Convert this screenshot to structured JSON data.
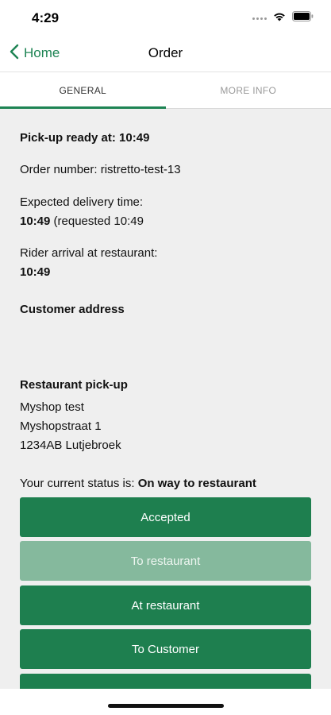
{
  "status_bar": {
    "time": "4:29"
  },
  "nav": {
    "back_label": "Home",
    "title": "Order"
  },
  "tabs": [
    {
      "label": "GENERAL",
      "active": true
    },
    {
      "label": "MORE INFO",
      "active": false
    }
  ],
  "order": {
    "pickup_ready_label": "Pick-up ready at: ",
    "pickup_ready_time": "10:49",
    "order_number_label": "Order number: ",
    "order_number": "ristretto-test-13",
    "expected_delivery_label": "Expected delivery time:",
    "expected_delivery_time": "10:49",
    "expected_delivery_requested": " (requested 10:49",
    "rider_arrival_label": "Rider arrival at restaurant:",
    "rider_arrival_time": "10:49",
    "customer_address_heading": "Customer address",
    "restaurant_pickup_heading": "Restaurant pick-up",
    "restaurant_name": "Myshop test",
    "restaurant_street": "Myshopstraat 1",
    "restaurant_city": "1234AB Lutjebroek",
    "status_label": "Your current status is: ",
    "status_value": "On way to restaurant"
  },
  "actions": [
    {
      "label": "Accepted",
      "enabled": true
    },
    {
      "label": "To restaurant",
      "enabled": false
    },
    {
      "label": "At restaurant",
      "enabled": true
    },
    {
      "label": "To Customer",
      "enabled": true
    },
    {
      "label": "",
      "enabled": true
    }
  ],
  "colors": {
    "accent": "#1e8454",
    "button": "#1e7f4f",
    "button_disabled": "#85b99d",
    "background": "#efefef"
  }
}
